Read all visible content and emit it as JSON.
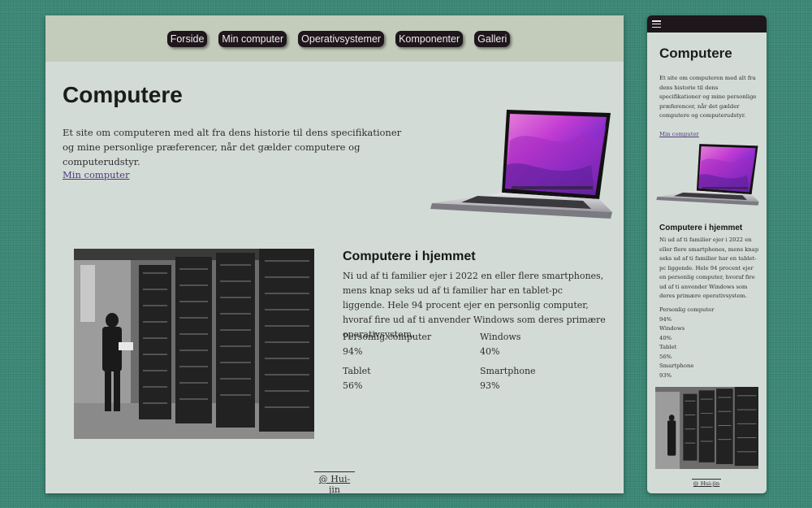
{
  "nav": {
    "items": [
      "Forside",
      "Min computer",
      "Operativsystemer",
      "Komponenter",
      "Galleri"
    ]
  },
  "hero": {
    "title": "Computere",
    "intro": "Et site om computeren med alt fra dens historie til dens specifikationer og mine personlige præferencer, når det gælder computere og computerudstyr.",
    "link": "Min computer"
  },
  "home_section": {
    "heading": "Computere i hjemmet",
    "text": "Ni ud af ti familier ejer i 2022 en eller flere smartphones, mens knap seks ud af ti familier har en tablet-pc liggende. Hele 94 procent ejer en personlig computer, hvoraf fire ud af ti anvender Windows som deres primære operativsystem.",
    "stats": [
      {
        "label": "Personlig computer",
        "value": "94%"
      },
      {
        "label": "Windows",
        "value": "40%"
      },
      {
        "label": "Tablet",
        "value": "56%"
      },
      {
        "label": "Smartphone",
        "value": "93%"
      }
    ]
  },
  "footer": {
    "text": "@ Hui-jin"
  },
  "icons": {
    "mobile_menu": "hamburger-menu-icon"
  },
  "colors": {
    "background": "#3f8a78",
    "page": "#d3dbd6",
    "nav_bar": "#c3ccbb",
    "nav_button": "#1d161b",
    "link": "#4b3a7a"
  }
}
